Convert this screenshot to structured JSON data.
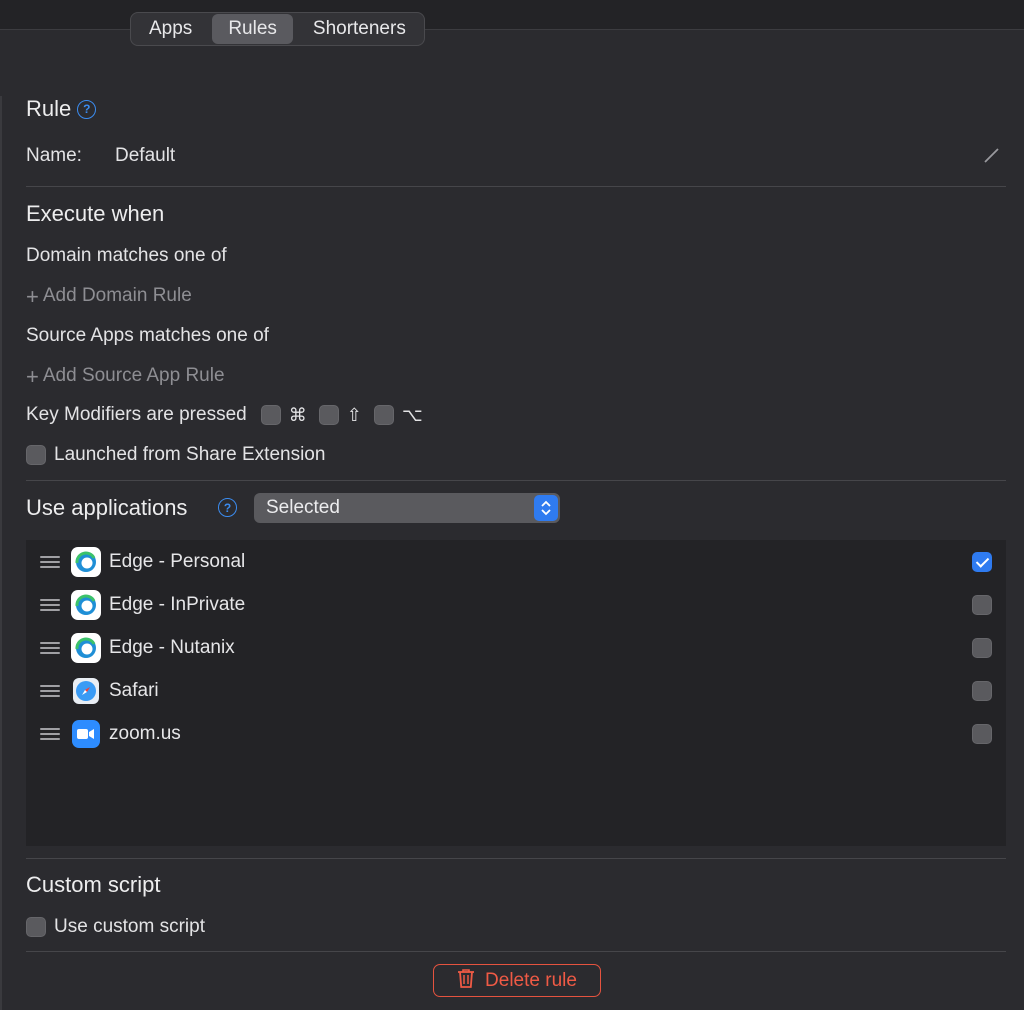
{
  "tabs": [
    {
      "label": "Apps",
      "active": false
    },
    {
      "label": "Rules",
      "active": true
    },
    {
      "label": "Shorteners",
      "active": false
    }
  ],
  "rule": {
    "title": "Rule",
    "name_label": "Name:",
    "name_value": "Default"
  },
  "execute": {
    "title": "Execute when",
    "domain_label": "Domain matches one of",
    "add_domain": "Add Domain Rule",
    "source_label": "Source Apps matches one of",
    "add_source": "Add Source App Rule",
    "modifiers_label": "Key Modifiers are pressed",
    "modifiers": [
      {
        "symbol": "⌘",
        "checked": false
      },
      {
        "symbol": "⇧",
        "checked": false
      },
      {
        "symbol": "⌥",
        "checked": false
      }
    ],
    "share_label": "Launched from Share Extension",
    "share_checked": false
  },
  "applications": {
    "title": "Use applications",
    "select_value": "Selected",
    "items": [
      {
        "name": "Edge - Personal",
        "icon": "edge-icon",
        "checked": true
      },
      {
        "name": "Edge - InPrivate",
        "icon": "edge-icon",
        "checked": false
      },
      {
        "name": "Edge - Nutanix",
        "icon": "edge-icon",
        "checked": false
      },
      {
        "name": "Safari",
        "icon": "safari-icon",
        "checked": false
      },
      {
        "name": "zoom.us",
        "icon": "zoom-icon",
        "checked": false
      }
    ]
  },
  "custom_script": {
    "title": "Custom script",
    "checkbox_label": "Use custom script",
    "checked": false
  },
  "delete_label": "Delete rule",
  "colors": {
    "accent": "#2f7bf0",
    "danger": "#ef5a45",
    "background": "#2b2b2f"
  }
}
